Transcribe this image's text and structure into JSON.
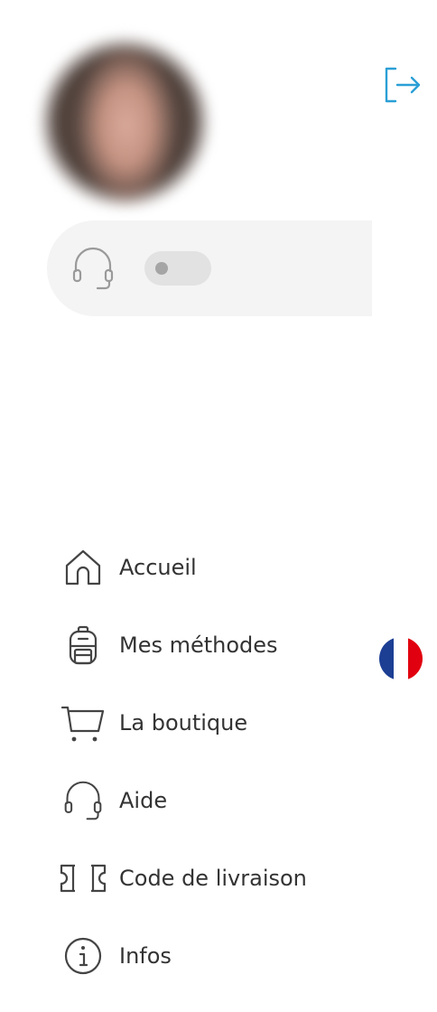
{
  "header": {
    "avatar_icon": "user-avatar",
    "logout_icon": "logout-icon",
    "accent_color": "#2a9fd6"
  },
  "support": {
    "icon": "headset-icon",
    "toggle_state": "off"
  },
  "menu": {
    "items": [
      {
        "label": "Accueil",
        "icon": "home-icon"
      },
      {
        "label": "Mes méthodes",
        "icon": "backpack-icon"
      },
      {
        "label": "La boutique",
        "icon": "cart-icon"
      },
      {
        "label": "Aide",
        "icon": "headset-icon"
      },
      {
        "label": "Code de livraison",
        "icon": "ticket-icon"
      },
      {
        "label": "Infos",
        "icon": "info-icon"
      }
    ]
  },
  "language": {
    "flag_icon": "flag-france-icon",
    "colors": [
      "#1c3f94",
      "#ffffff",
      "#e1000f"
    ]
  }
}
